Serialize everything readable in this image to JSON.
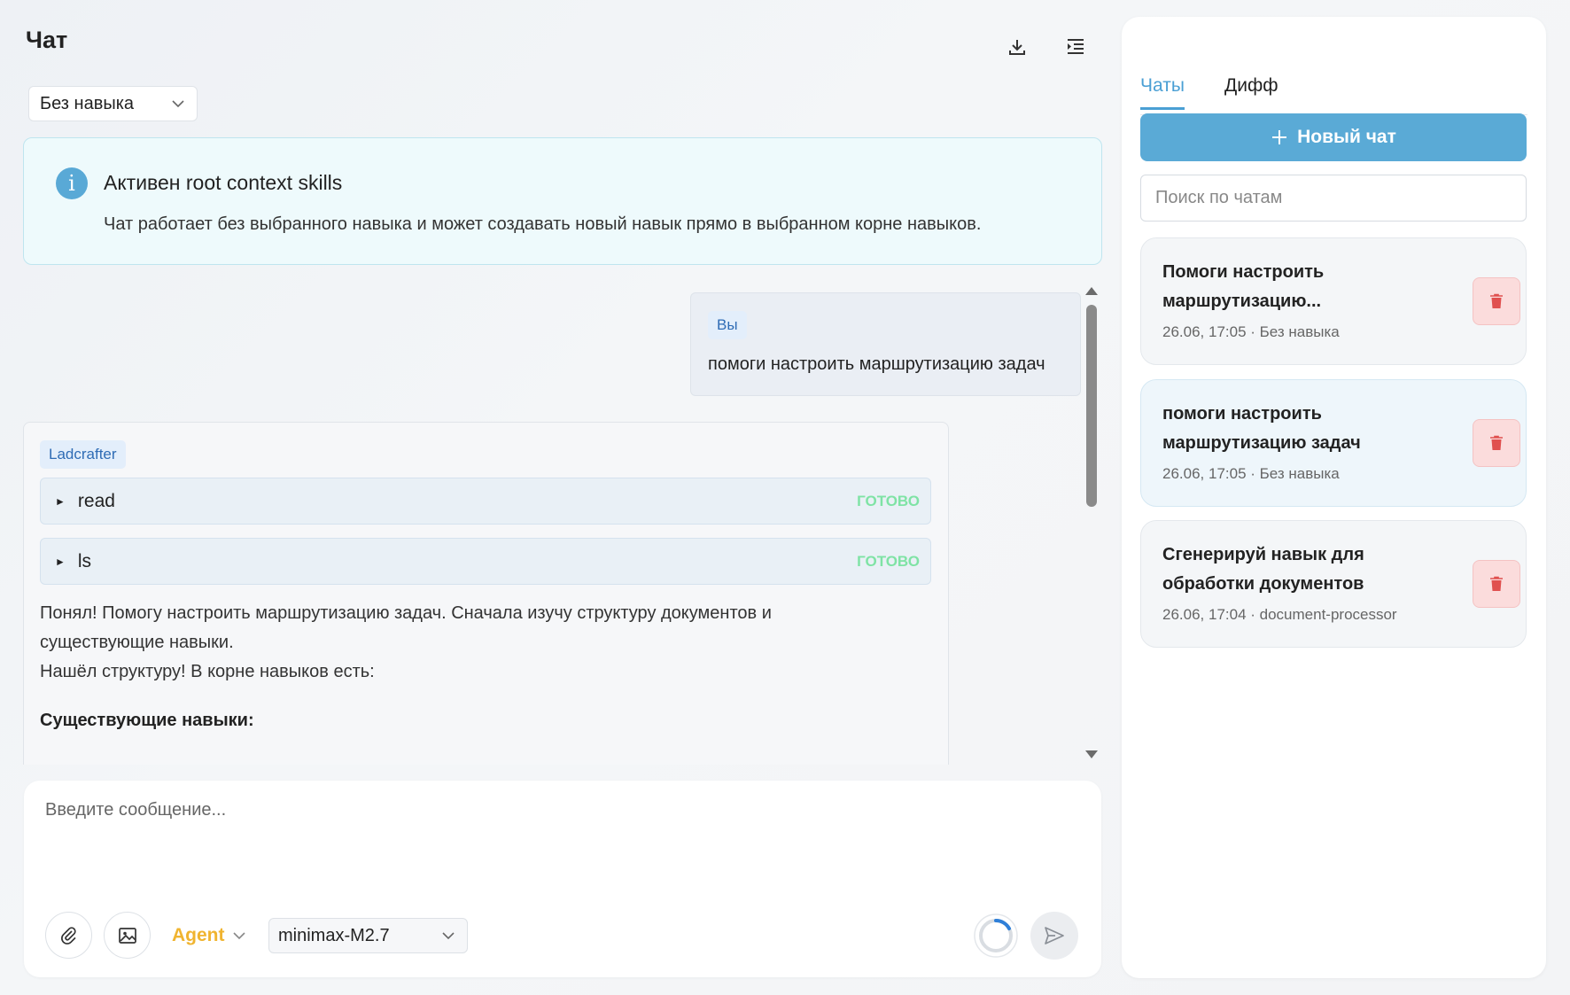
{
  "header": {
    "title": "Чат",
    "download_icon": "download-icon",
    "menu_icon": "list-indent-icon"
  },
  "skill_select": {
    "value": "Без навыка"
  },
  "info": {
    "icon": "info-icon",
    "title": "Активен root context skills",
    "text": "Чат работает без выбранного навыка и может создавать новый навык прямо в выбранном корне навыков."
  },
  "messages": {
    "user": {
      "author": "Вы",
      "text": "помоги настроить маршрутизацию задач"
    },
    "assistant": {
      "author": "Ladcrafter",
      "tools": [
        {
          "name": "read",
          "status": "ГОТОВО"
        },
        {
          "name": "ls",
          "status": "ГОТОВО"
        }
      ],
      "lines": [
        "Понял! Помогу настроить маршрутизацию задач. Сначала изучу структуру документов и",
        "существующие навыки.",
        "Нашёл структуру! В корне навыков есть:"
      ],
      "heading": "Существующие навыки:"
    }
  },
  "composer": {
    "placeholder": "Введите сообщение...",
    "mode": "Agent",
    "model": "minimax-M2.7",
    "accent_color": "#f0b430"
  },
  "sidebar": {
    "tabs": [
      {
        "label": "Чаты",
        "active": true
      },
      {
        "label": "Дифф",
        "active": false
      }
    ],
    "new_chat_label": "Новый чат",
    "search_placeholder": "Поиск по чатам",
    "chats": [
      {
        "title": "Помоги настроить маршрутизацию...",
        "meta": "26.06, 17:05 · Без навыка",
        "active": false
      },
      {
        "title": "помоги настроить маршрутизацию задач",
        "meta": "26.06, 17:05 · Без навыка",
        "active": true
      },
      {
        "title": "Сгенерируй навык для обработки документов",
        "meta": "26.06, 17:04 · document-processor",
        "active": false
      }
    ],
    "accent_color": "#5aaad6"
  }
}
